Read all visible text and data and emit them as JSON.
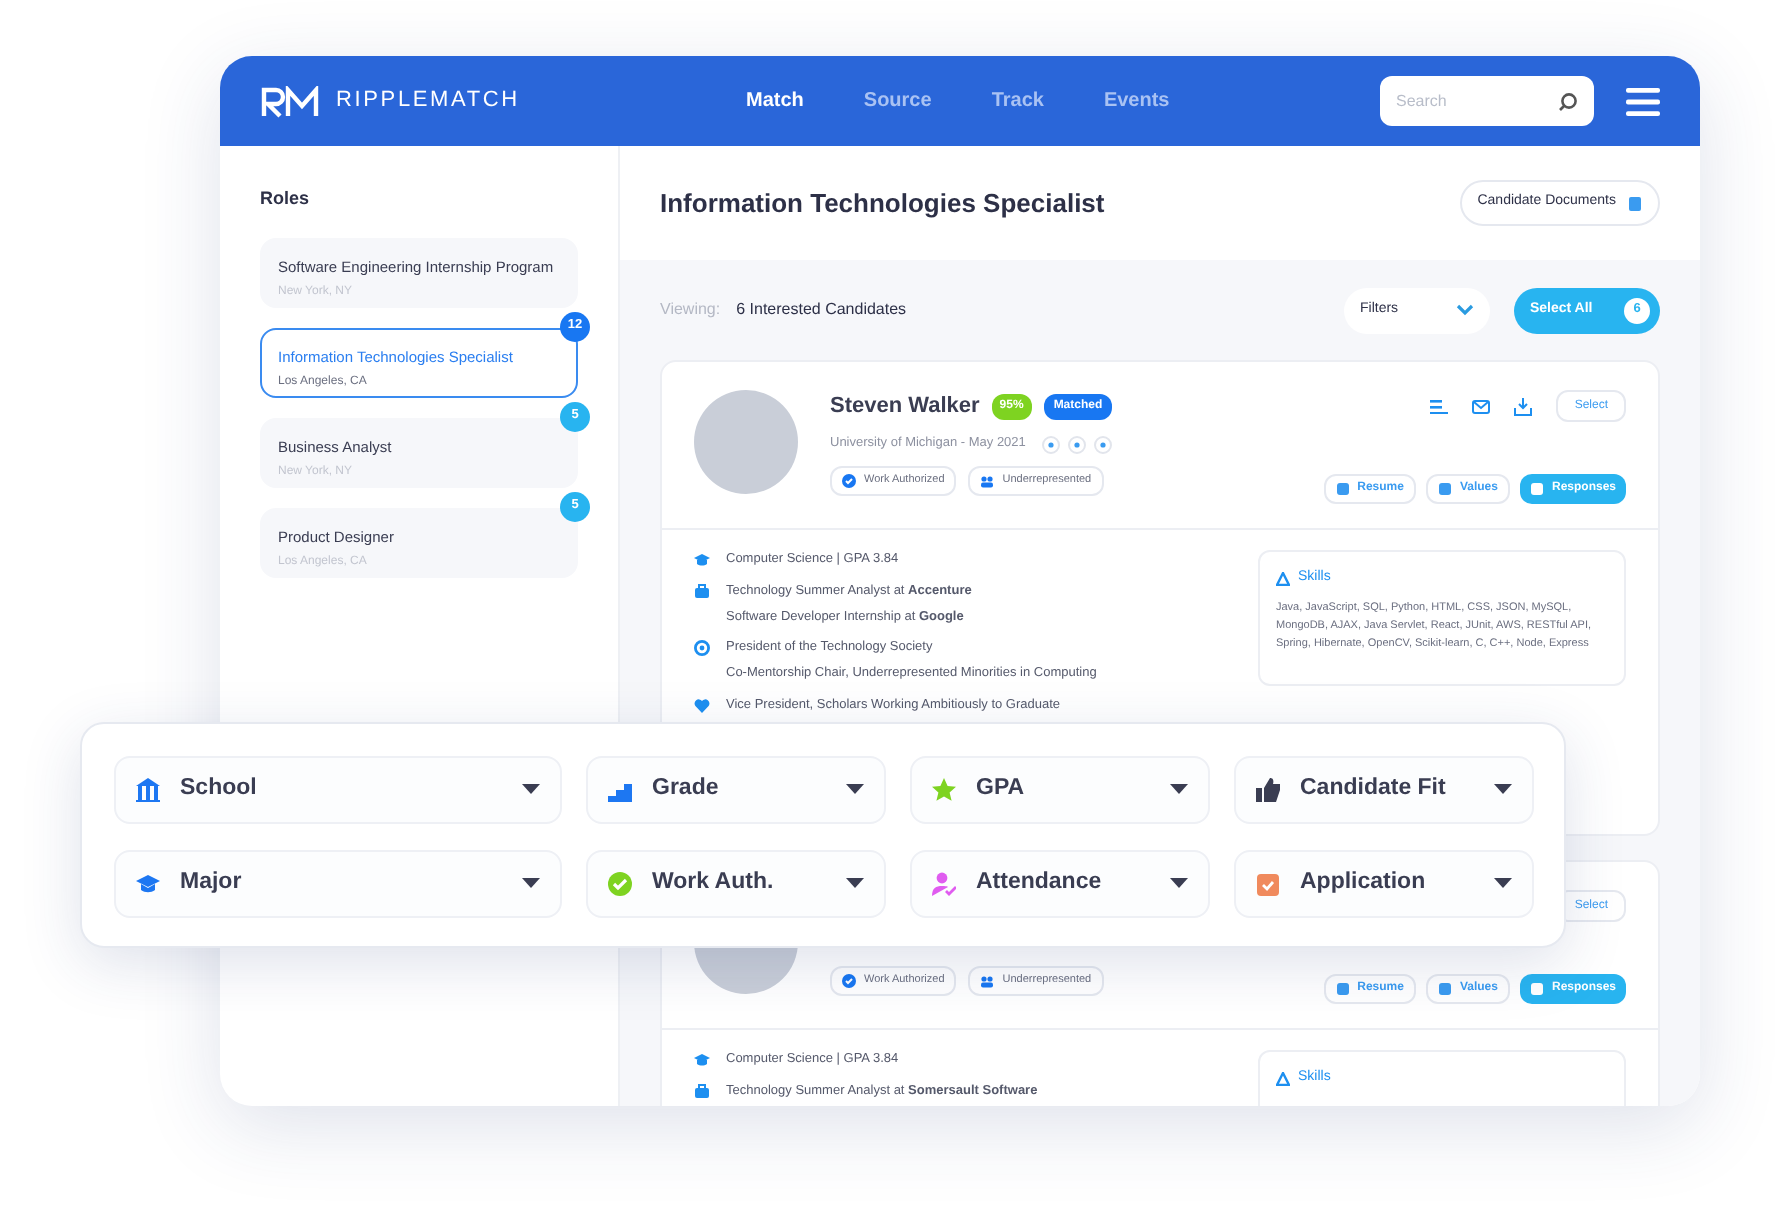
{
  "header": {
    "brand": "RIPPLEMATCH",
    "nav": [
      {
        "label": "Match",
        "selected": true
      },
      {
        "label": "Source",
        "selected": false
      },
      {
        "label": "Track",
        "selected": false
      },
      {
        "label": "Events",
        "selected": false
      }
    ],
    "search": {
      "placeholder": "Search"
    }
  },
  "sidebar": {
    "title": "Roles",
    "roles": [
      {
        "title": "Software Engineering Internship Program",
        "location": "New York, NY",
        "selected": false
      },
      {
        "title": "Information Technologies Specialist",
        "location": "Los Angeles, CA",
        "selected": true,
        "count": "12"
      },
      {
        "title": "Business Analyst",
        "location": "New York, NY",
        "selected": false,
        "count": "5"
      },
      {
        "title": "Product Designer",
        "location": "Los Angeles, CA",
        "selected": false,
        "count": "5"
      }
    ]
  },
  "main": {
    "title": "Information Technologies Specialist",
    "documents_button": "Candidate Documents",
    "viewing_label": "Viewing:",
    "viewing_value": "6 Interested Candidates",
    "filters_button": "Filters",
    "select_all": {
      "label": "Select All",
      "count": "6"
    }
  },
  "candidates": [
    {
      "name": "Steven Walker",
      "score": "95%",
      "status": "Matched",
      "school": "University of Michigan - May 2021",
      "select": "Select",
      "tags": [
        "Work Authorized",
        "Underrepresented"
      ],
      "buttons": [
        {
          "label": "Resume",
          "selected": false
        },
        {
          "label": "Values",
          "selected": false
        },
        {
          "label": "Responses",
          "selected": true
        }
      ],
      "details": [
        {
          "kind": "education",
          "lines": [
            "Computer Science | GPA 3.84"
          ]
        },
        {
          "kind": "work",
          "lines": [
            "Technology Summer Analyst at **Accenture**",
            "Software Developer Internship at **Google**"
          ]
        },
        {
          "kind": "leadership",
          "lines": [
            "President of the Technology Society",
            "Co-Mentorship Chair, Underrepresented Minorities in Computing"
          ]
        },
        {
          "kind": "honor",
          "lines": [
            "Vice President, Scholars Working Ambitiously to Graduate"
          ]
        }
      ],
      "skills": {
        "title": "Skills",
        "text": "Java, JavaScript, SQL, Python, HTML, CSS, JSON, MySQL, MongoDB, AJAX, Java Servlet, React, JUnit, AWS, RESTful API, Spring, Hibernate, OpenCV, Scikit-learn, C, C++, Node, Express"
      }
    },
    {
      "select": "Select",
      "tags": [
        "Work Authorized",
        "Underrepresented"
      ],
      "buttons": [
        {
          "label": "Resume",
          "selected": false
        },
        {
          "label": "Values",
          "selected": false
        },
        {
          "label": "Responses",
          "selected": true
        }
      ],
      "details": [
        {
          "kind": "education",
          "lines": [
            "Computer Science | GPA 3.84"
          ]
        },
        {
          "kind": "work",
          "lines": [
            "Technology Summer Analyst at **Somersault Software**"
          ]
        }
      ],
      "skills": {
        "title": "Skills"
      }
    }
  ],
  "filters": [
    {
      "kind": "school",
      "label": "School"
    },
    {
      "kind": "grade",
      "label": "Grade"
    },
    {
      "kind": "gpa",
      "label": "GPA"
    },
    {
      "kind": "fit",
      "label": "Candidate Fit"
    },
    {
      "kind": "major",
      "label": "Major"
    },
    {
      "kind": "work",
      "label": "Work Auth."
    },
    {
      "kind": "attendance",
      "label": "Attendance"
    },
    {
      "kind": "application",
      "label": "Application"
    }
  ]
}
